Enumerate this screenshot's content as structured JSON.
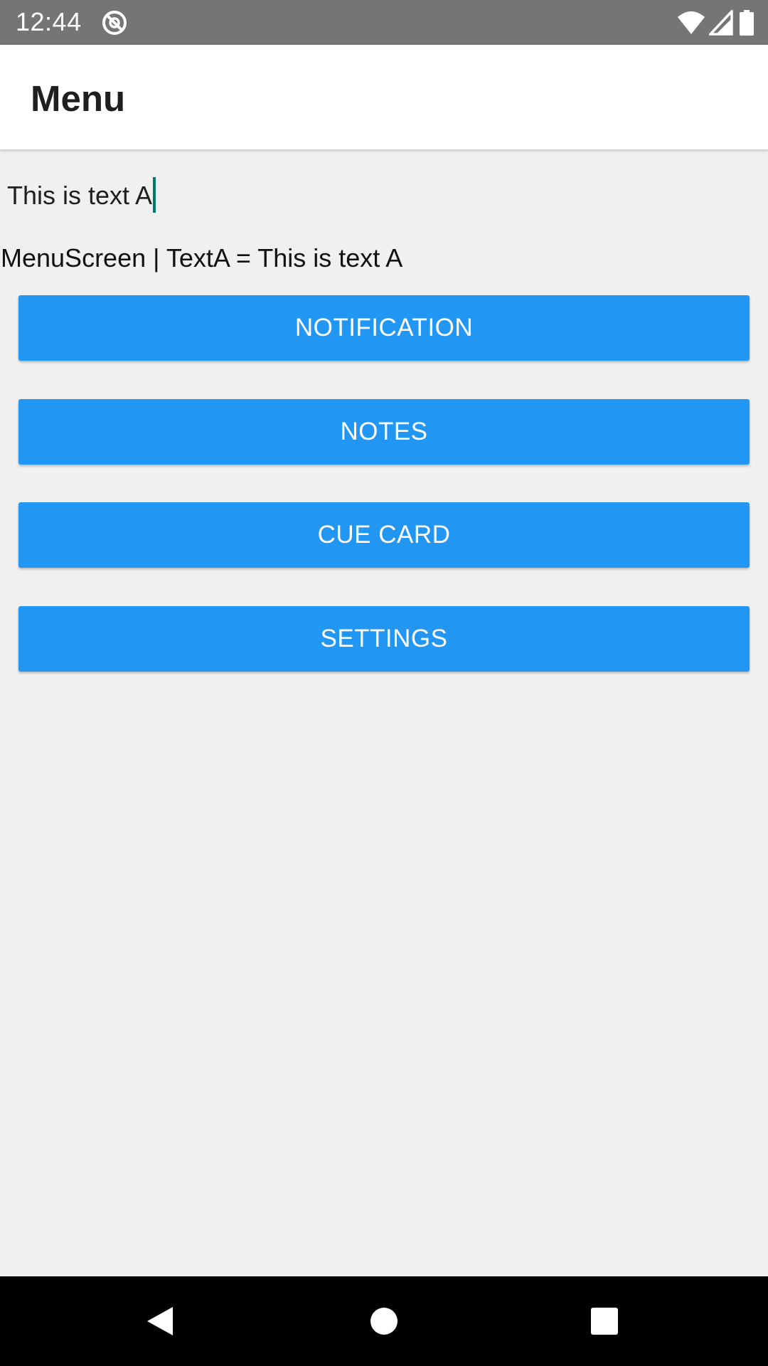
{
  "status_bar": {
    "time": "12:44",
    "icons": [
      "dnd-icon",
      "wifi-icon",
      "cell-signal-icon",
      "battery-icon"
    ]
  },
  "app_bar": {
    "title": "Menu"
  },
  "input": {
    "value": "This is text A"
  },
  "info": {
    "text": "MenuScreen | TextA = This is text A"
  },
  "buttons": [
    {
      "label": "NOTIFICATION"
    },
    {
      "label": "NOTES"
    },
    {
      "label": "CUE CARD"
    },
    {
      "label": "SETTINGS"
    }
  ],
  "nav_bar": {
    "icons": [
      "back-icon",
      "home-icon",
      "recents-icon"
    ]
  },
  "colors": {
    "status_bar": "#757575",
    "button": "#2196f3",
    "caret": "#00796b",
    "background": "#f0f0f0"
  }
}
